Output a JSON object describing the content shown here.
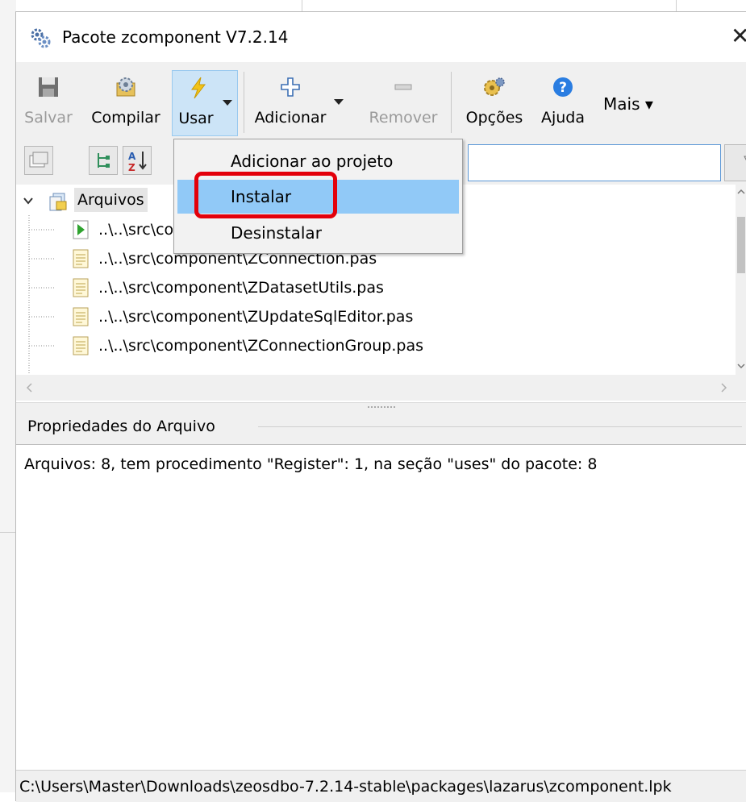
{
  "window": {
    "title": "Pacote zcomponent V7.2.14",
    "close_glyph": "✕"
  },
  "toolbar": {
    "save_label": "Salvar",
    "compile_label": "Compilar",
    "use_label": "Usar",
    "add_label": "Adicionar",
    "remove_label": "Remover",
    "options_label": "Opções",
    "help_label": "Ajuda",
    "more_label": "Mais ▾"
  },
  "use_menu": {
    "items": [
      {
        "label": "Adicionar ao projeto"
      },
      {
        "label": "Instalar",
        "highlighted": true
      },
      {
        "label": "Desinstalar"
      }
    ]
  },
  "tree": {
    "root_label": "Arquivos",
    "files": [
      {
        "label": "..\\..\\src\\component\\ZComponentReg.pas",
        "icon": "register-unit-icon"
      },
      {
        "label": "..\\..\\src\\component\\ZConnection.pas",
        "icon": "unit-file-icon"
      },
      {
        "label": "..\\..\\src\\component\\ZDatasetUtils.pas",
        "icon": "unit-file-icon"
      },
      {
        "label": "..\\..\\src\\component\\ZUpdateSqlEditor.pas",
        "icon": "unit-file-icon"
      },
      {
        "label": "..\\..\\src\\component\\ZConnectionGroup.pas",
        "icon": "unit-file-icon"
      }
    ]
  },
  "properties": {
    "title": "Propriedades do Arquivo",
    "summary": "Arquivos: 8, tem procedimento \"Register\": 1, na seção \"uses\" do pacote: 8"
  },
  "status": {
    "path": "C:\\Users\\Master\\Downloads\\zeosdbo-7.2.14-stable\\packages\\lazarus\\zcomponent.lpk"
  },
  "colors": {
    "highlight": "#91c9f7",
    "annotation": "#e3000b",
    "pressed": "#cce4f7"
  }
}
